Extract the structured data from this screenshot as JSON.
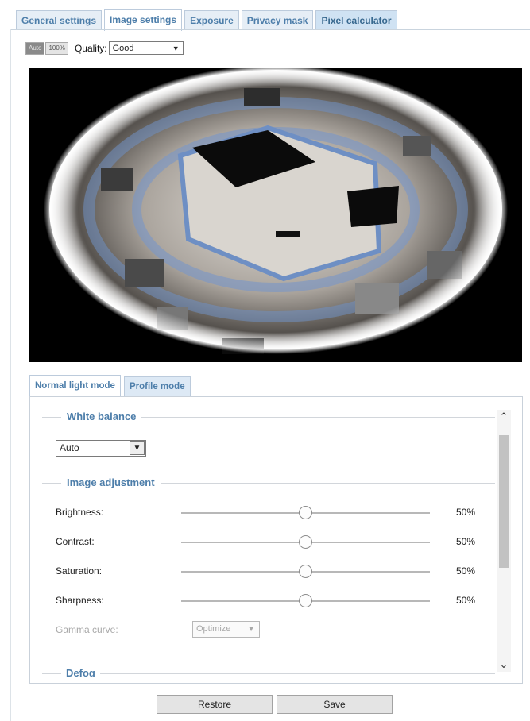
{
  "tabs": [
    {
      "label": "General settings"
    },
    {
      "label": "Image settings"
    },
    {
      "label": "Exposure"
    },
    {
      "label": "Privacy mask"
    },
    {
      "label": "Pixel calculator"
    }
  ],
  "view_controls": {
    "fit_label": "Auto",
    "zoom_label": "100%",
    "quality_label": "Quality:",
    "quality_value": "Good"
  },
  "mode_tabs": [
    {
      "label": "Normal light mode"
    },
    {
      "label": "Profile mode"
    }
  ],
  "white_balance": {
    "title": "White balance",
    "value": "Auto"
  },
  "image_adjustment": {
    "title": "Image adjustment",
    "rows": [
      {
        "label": "Brightness:",
        "value": "50%",
        "level": 0.5
      },
      {
        "label": "Contrast:",
        "value": "50%",
        "level": 0.5
      },
      {
        "label": "Saturation:",
        "value": "50%",
        "level": 0.5
      },
      {
        "label": "Sharpness:",
        "value": "50%",
        "level": 0.5
      }
    ],
    "gamma_label": "Gamma curve:",
    "gamma_value": "Optimize"
  },
  "defog": {
    "title": "Defog"
  },
  "buttons": {
    "restore": "Restore",
    "save": "Save"
  }
}
